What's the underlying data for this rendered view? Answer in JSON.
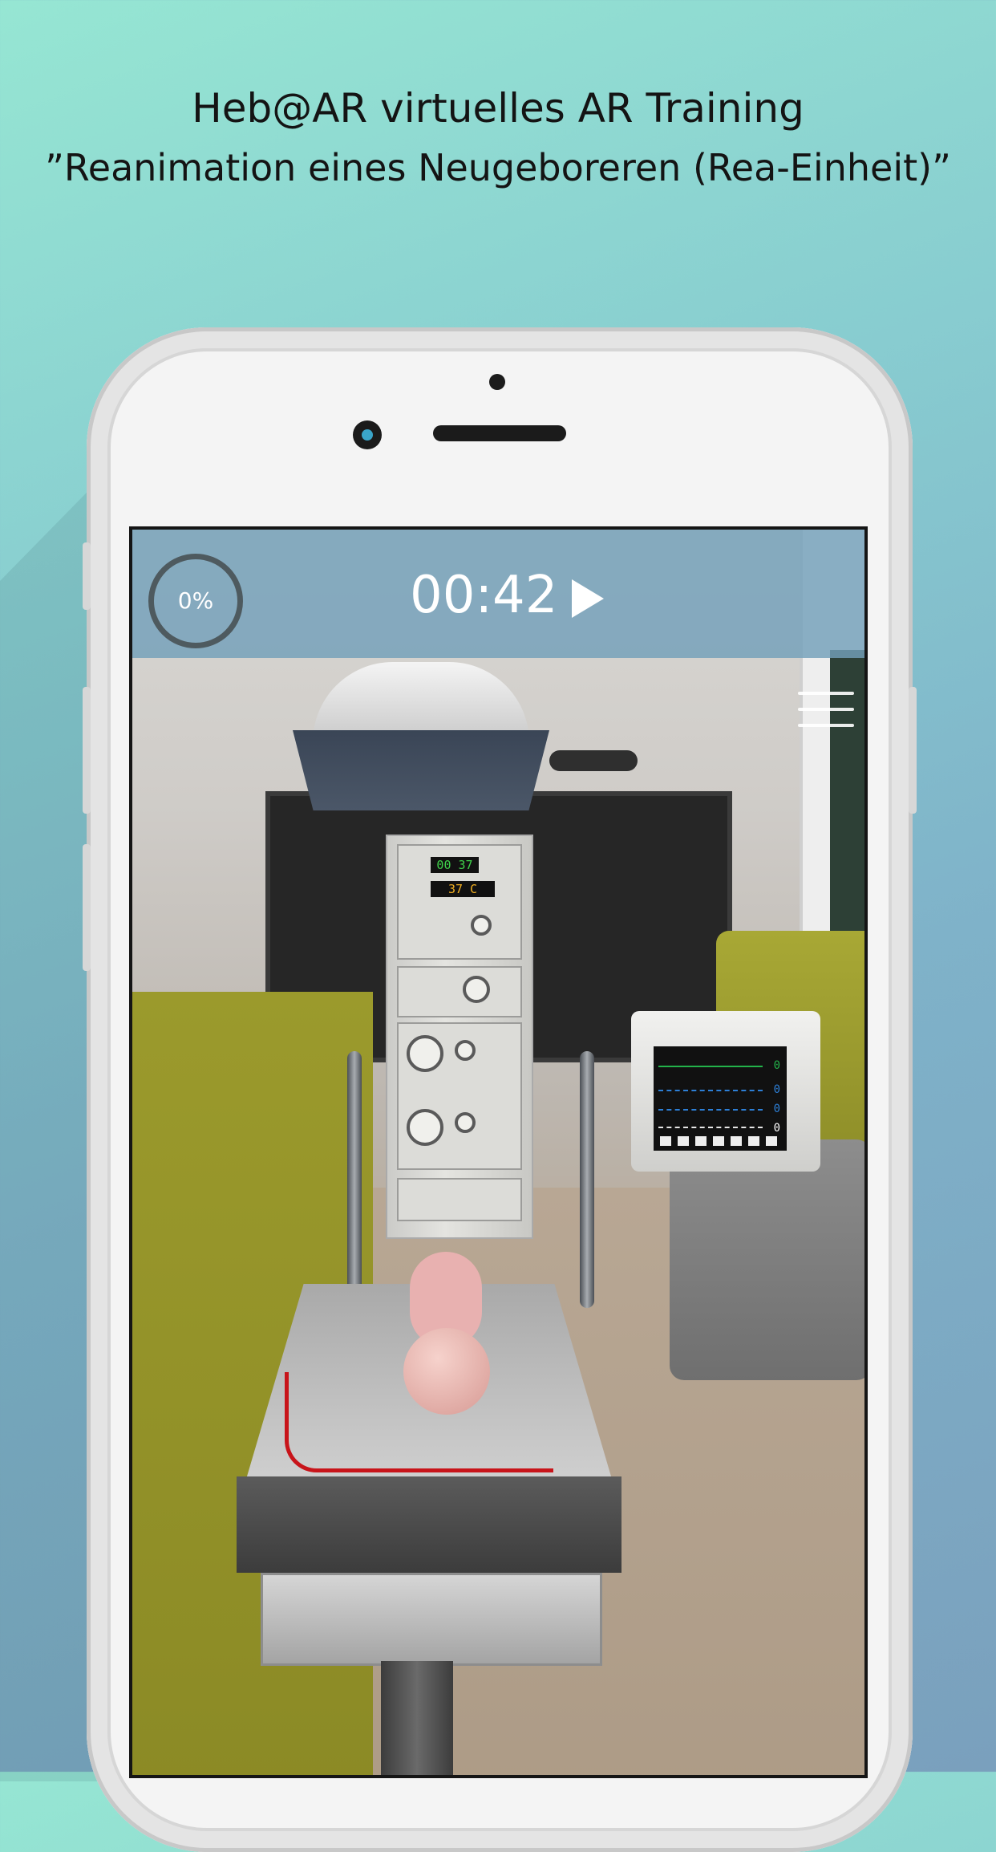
{
  "header": {
    "title_line1": "Heb@AR virtuelles AR Training",
    "title_line2": "”Reanimation eines Neugeboreren (Rea-Einheit)”"
  },
  "device": {
    "model": "smartphone",
    "camera_lens_color": "#3aa5c9"
  },
  "app": {
    "progress_label": "0%",
    "progress_value": 0,
    "timer": "00:42",
    "play_icon": "play-icon",
    "menu_icon": "hamburger-menu-icon",
    "hud_color": "#73a0b9"
  },
  "scene": {
    "warmer_display_top": "00 37",
    "warmer_display_temp": "37 C",
    "monitor_values": [
      "0",
      "0",
      "0",
      "0"
    ],
    "tube_color": "#c8141a"
  },
  "background": {
    "gradient": [
      "#96e6d3",
      "#88cdd0",
      "#7fb2c9",
      "#7aa0bd"
    ]
  }
}
